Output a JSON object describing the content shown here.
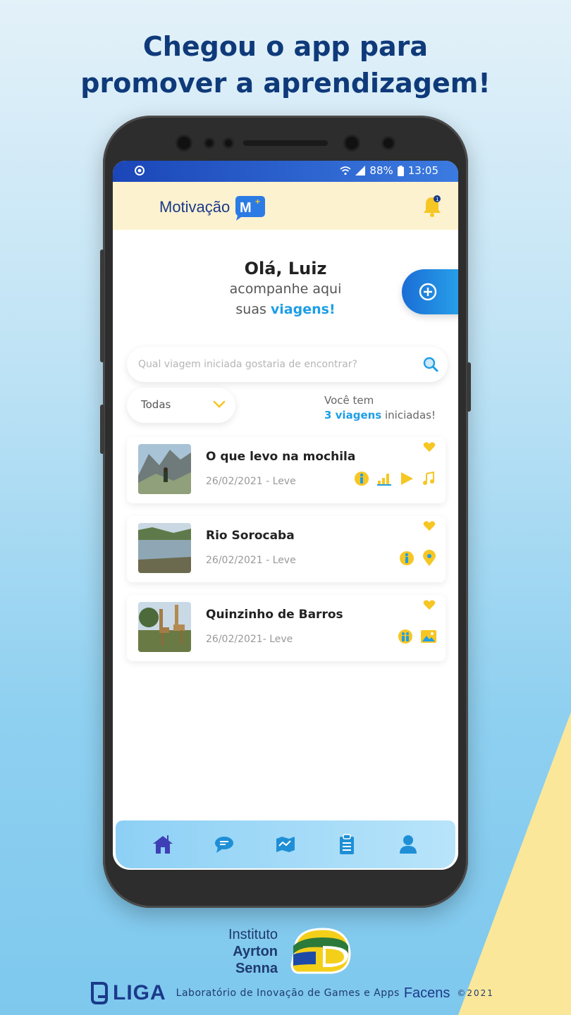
{
  "promo": {
    "headline_line1": "Chegou o app para",
    "headline_line2": "promover a aprendizagem!"
  },
  "statusbar": {
    "battery": "88%",
    "time": "13:05"
  },
  "header": {
    "brand": "Motivação",
    "brand_badge": "M+",
    "notification_count": "1"
  },
  "greeting": {
    "title": "Olá, Luiz",
    "line1": "acompanhe aqui",
    "line2_prefix": "suas ",
    "line2_highlight": "viagens!"
  },
  "search": {
    "placeholder": "Qual viagem iniciada gostaria de encontrar?"
  },
  "filter": {
    "selected": "Todas"
  },
  "summary": {
    "prefix": "Você tem",
    "count_text": "3 viagens",
    "suffix": " iniciadas!"
  },
  "trips": [
    {
      "title": "O que levo na mochila",
      "date": "26/02/2021 - Leve",
      "icons": [
        "person-icon",
        "bar-chart-icon",
        "play-icon",
        "music-icon"
      ]
    },
    {
      "title": "Rio Sorocaba",
      "date": "26/02/2021 - Leve",
      "icons": [
        "person-icon",
        "location-pin-icon"
      ]
    },
    {
      "title": "Quinzinho de Barros",
      "date": "26/02/2021- Leve",
      "icons": [
        "group-icon",
        "image-icon"
      ]
    }
  ],
  "nav": [
    "home-icon",
    "chat-icon",
    "map-icon",
    "clipboard-icon",
    "profile-icon"
  ],
  "footer": {
    "institute_line1": "Instituto",
    "institute_line2": "Ayrton",
    "institute_line3": "Senna",
    "liga": "LIGA",
    "lab": "Laboratório de Inovação de Games e Apps",
    "facens": "Facens",
    "copyright": "©2021"
  },
  "colors": {
    "accent": "#1e9ee6",
    "icon_yellow": "#f6c623",
    "navy": "#0f3a7a"
  }
}
